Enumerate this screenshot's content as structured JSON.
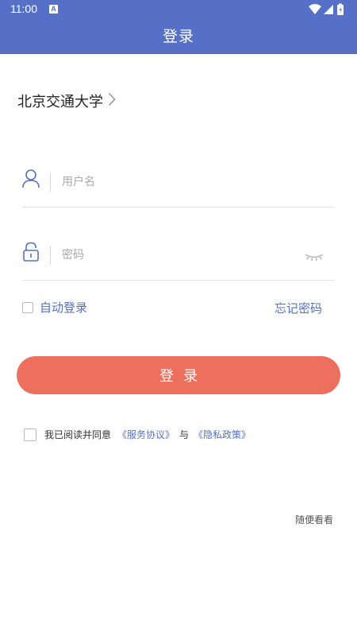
{
  "status_bar": {
    "time": "11:00",
    "notification_icon": "a-badge-icon",
    "icons": [
      "wifi-icon",
      "signal-icon",
      "battery-icon"
    ]
  },
  "app_bar": {
    "title": "登录"
  },
  "school": {
    "name": "北京交通大学",
    "icon": "chevron-right-icon"
  },
  "username": {
    "placeholder": "用户名",
    "value": "",
    "icon": "user-icon"
  },
  "password": {
    "placeholder": "密码",
    "value": "",
    "icon": "lock-icon",
    "toggle_icon": "eye-closed-icon"
  },
  "auto_login": {
    "label": "自动登录",
    "checked": false
  },
  "forgot_password": {
    "label": "忘记密码"
  },
  "login_button": {
    "label": "登录"
  },
  "agreement": {
    "checked": false,
    "prefix": "我已阅读并同意",
    "service_link": "《服务协议》",
    "and": "与",
    "privacy_link": "《隐私政策》"
  },
  "browse": {
    "label": "随便看看"
  },
  "colors": {
    "primary": "#5570c6",
    "button": "#ed6f5e"
  }
}
